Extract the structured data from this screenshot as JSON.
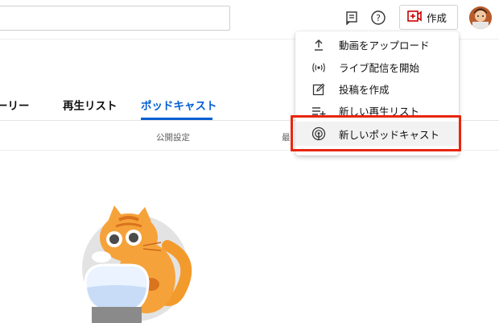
{
  "header": {
    "search": {
      "placeholder": ""
    },
    "feedback_icon": "feedback-icon",
    "help_icon": "help-icon",
    "create_label": "作成",
    "avatar": "avatar"
  },
  "tabs": [
    {
      "label": "ーリー"
    },
    {
      "label": "再生リスト"
    },
    {
      "label": "ポッドキャスト",
      "active": true
    }
  ],
  "columns": {
    "visibility": "公開設定",
    "date": "最"
  },
  "menu": {
    "items": [
      {
        "label": "動画をアップロード",
        "icon": "upload-icon"
      },
      {
        "label": "ライブ配信を開始",
        "icon": "live-icon"
      },
      {
        "label": "投稿を作成",
        "icon": "edit-icon"
      },
      {
        "label": "新しい再生リスト",
        "icon": "playlist-add-icon"
      },
      {
        "label": "新しいポッドキャスト",
        "icon": "podcast-icon",
        "highlighted": true
      }
    ]
  },
  "colors": {
    "accent": "#065fd4",
    "highlight": "#e8250f",
    "create_icon": "#cc0000"
  }
}
